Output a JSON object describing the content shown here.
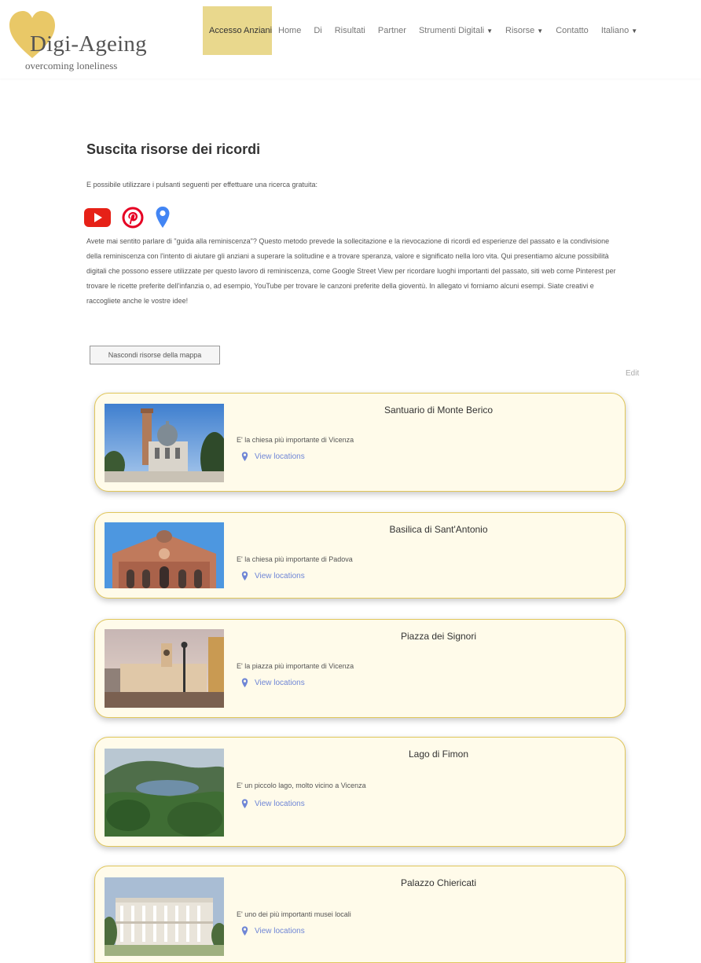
{
  "logo": {
    "title": "Digi-Ageing",
    "subtitle": "overcoming loneliness"
  },
  "nav": {
    "items": [
      {
        "label": "Accesso Anziani",
        "active": true
      },
      {
        "label": "Home"
      },
      {
        "label": "Di"
      },
      {
        "label": "Risultati"
      },
      {
        "label": "Partner"
      },
      {
        "label": "Strumenti Digitali",
        "dropdown": true
      },
      {
        "label": "Risorse",
        "dropdown": true
      },
      {
        "label": "Contatto"
      },
      {
        "label": "Italiano",
        "dropdown": true
      }
    ]
  },
  "page": {
    "title": "Suscita risorse dei ricordi",
    "intro": "E possibile utilizzare i pulsanti seguenti per effettuare una ricerca gratuita:",
    "description": "Avete mai sentito parlare di \"guida alla reminiscenza\"? Questo metodo prevede la sollecitazione e la rievocazione di ricordi ed esperienze del passato e la condivisione della reminiscenza con l'intento di aiutare gli anziani a superare la solitudine e a trovare speranza, valore e significato nella loro vita. Qui presentiamo alcune possibilità digitali che possono essere utilizzate per questo lavoro di reminiscenza, come Google Street View per ricordare luoghi importanti del passato, siti web come Pinterest per trovare le ricette preferite dell'infanzia o, ad esempio, YouTube per trovare le canzoni preferite della gioventù. In allegato vi forniamo alcuni esempi. Siate creativi e raccogliete anche le vostre idee!",
    "toggle_button": "Nascondi risorse della mappa",
    "edit_link": "Edit"
  },
  "colors": {
    "accent": "#e9d88d",
    "card_bg": "#fffbea",
    "card_border": "#e0c65a",
    "link": "#6f86d6",
    "youtube": "#e62117",
    "pinterest": "#e60023",
    "maps": "#4285f4"
  },
  "icons": [
    "youtube-icon",
    "pinterest-icon",
    "map-pin-icon"
  ],
  "cards": [
    {
      "title": "Santuario di Monte Berico",
      "description": "E' la chiesa più importante di Vicenza",
      "link": "View locations"
    },
    {
      "title": "Basilica di Sant'Antonio",
      "description": "E' la chiesa più importante di Padova",
      "link": "View locations"
    },
    {
      "title": "Piazza dei Signori",
      "description": "E' la piazza più importante di Vicenza",
      "link": "View locations"
    },
    {
      "title": "Lago di Fimon",
      "description": "E' un piccolo lago, molto vicino a Vicenza",
      "link": "View locations"
    },
    {
      "title": "Palazzo Chiericati",
      "description": "E' uno dei più importanti musei locali",
      "link": "View locations"
    }
  ]
}
